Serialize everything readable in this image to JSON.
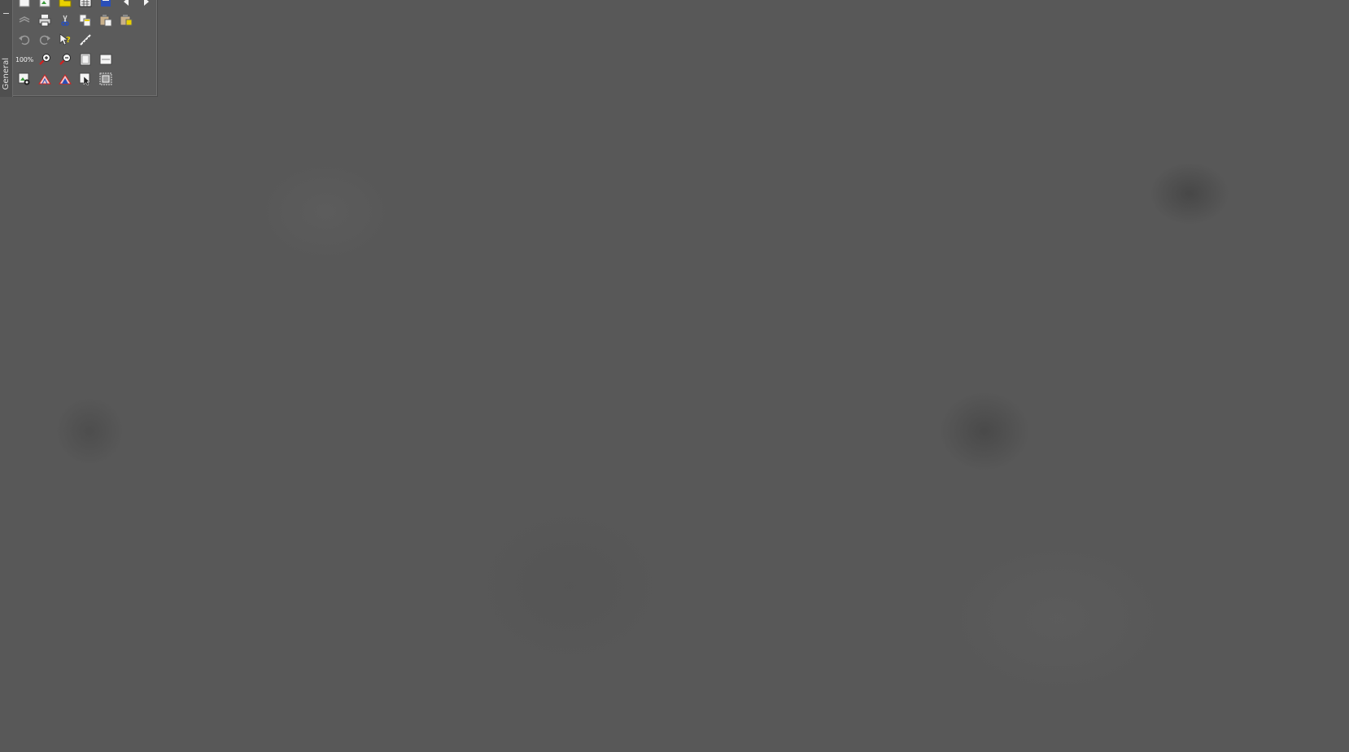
{
  "toolbar": {
    "panel_label": "General",
    "zoom_label": "100%",
    "rows": [
      [
        "new-file-icon",
        "new-image-icon",
        "open-folder-icon",
        "calendar-icon",
        "save-icon",
        "back-arrow-icon",
        "forward-arrow-icon"
      ],
      [
        "scan-icon",
        "print-icon",
        "cut-icon",
        "copy-icon",
        "paste-icon",
        "paste-special-icon"
      ],
      [
        "undo-icon",
        "redo-icon",
        "context-help-icon",
        "measure-icon"
      ],
      [
        "zoom-100-icon",
        "zoom-in-icon",
        "zoom-out-icon",
        "fit-page-icon",
        "fit-width-icon"
      ],
      [
        "acquire-icon",
        "histogram-icon",
        "histogram-color-icon",
        "select-icon",
        "crop-icon"
      ]
    ]
  },
  "colors": {
    "workspace_background": "#585858",
    "toolbar_background": "#5b5b5b",
    "accent_yellow": "#e8d000",
    "accent_blue": "#2a4fb8",
    "accent_red": "#d02020"
  }
}
